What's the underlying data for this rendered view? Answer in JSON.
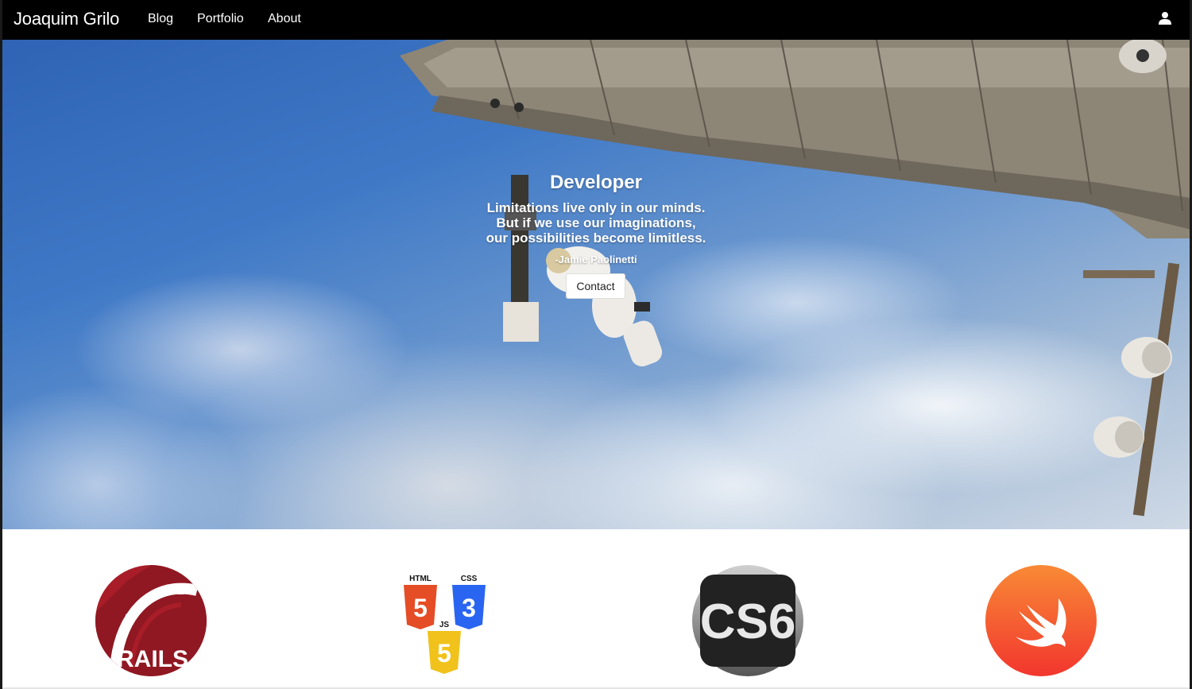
{
  "nav": {
    "brand": "Joaquim Grilo",
    "links": [
      "Blog",
      "Portfolio",
      "About"
    ],
    "user_icon": "user-icon"
  },
  "hero": {
    "title": "Developer",
    "quote_lines": [
      "Limitations live only in our minds.",
      "But if we use our imaginations,",
      "our possibilities become limitless."
    ],
    "author": "-Jamie Paolinetti",
    "contact_label": "Contact",
    "background": "astronaut spacewalk above earth clouds"
  },
  "skills": {
    "rails_text": "RAILS",
    "html_label": "HTML",
    "css_label": "CSS",
    "js_label": "JS",
    "cs6_text": "CS6",
    "swift_icon": "swift-bird-icon"
  },
  "colors": {
    "navbar": "#000000",
    "rails": "#a81d28",
    "html5": "#e44d26",
    "css3": "#2965f1",
    "js": "#f0c21b",
    "cs6": "#2b2b2b",
    "swift": "#f54a2f"
  }
}
